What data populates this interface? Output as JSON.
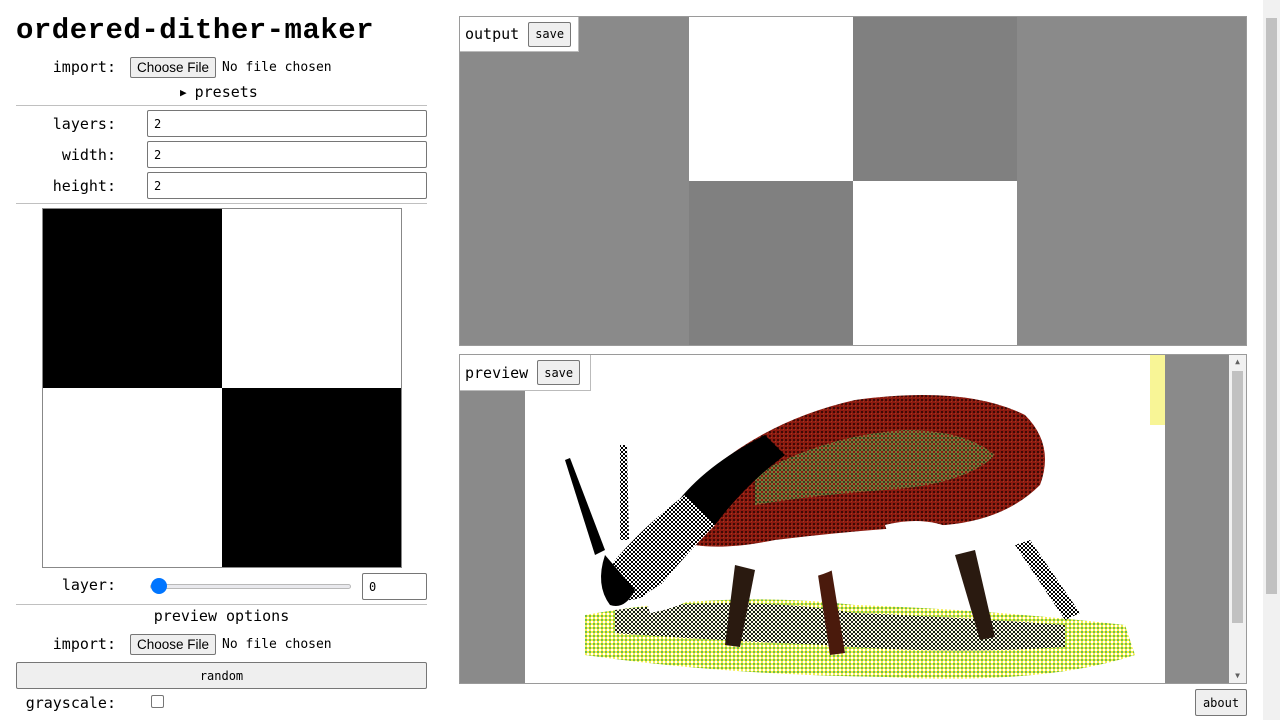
{
  "app": {
    "title": "ordered-dither-maker"
  },
  "import": {
    "label": "import:",
    "button": "Choose File",
    "status": "No file chosen"
  },
  "presets": {
    "label": "presets",
    "expanded": false
  },
  "settings": {
    "layers": {
      "label": "layers:",
      "value": "2"
    },
    "width": {
      "label": "width:",
      "value": "2"
    },
    "height": {
      "label": "height:",
      "value": "2"
    }
  },
  "grid": {
    "columns": 2,
    "rows": 2,
    "cells": [
      [
        "#000000",
        "#ffffff"
      ],
      [
        "#ffffff",
        "#000000"
      ]
    ]
  },
  "layer": {
    "label": "layer:",
    "slider_value": 0,
    "slider_max": 1,
    "value": "0"
  },
  "preview_options": {
    "heading": "preview options",
    "import_label": "import:",
    "button": "Choose File",
    "status": "No file chosen",
    "random": "random",
    "grayscale_label": "grayscale:",
    "grayscale_checked": false
  },
  "output": {
    "title": "output",
    "save": "save",
    "background": "#8a8a8a",
    "tile_colors": {
      "upper_left": "#ffffff",
      "upper_right": "#808080",
      "lower_left": "#808080",
      "lower_right": "#ffffff"
    }
  },
  "preview": {
    "title": "preview",
    "save": "save",
    "image": "dithered photo of a grazing deer",
    "palette": [
      "#000000",
      "#ffffff",
      "#8b1a10",
      "#7a7a3a",
      "#f4ee50",
      "#6fbf4a"
    ]
  },
  "about": {
    "label": "about"
  },
  "icons": {
    "presets_toggle": "triangle-right-icon",
    "scroll_up": "arrow-up-icon",
    "scroll_down": "arrow-down-icon"
  }
}
